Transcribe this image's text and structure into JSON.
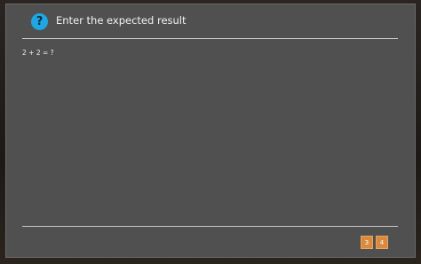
{
  "dialog": {
    "icon": "help-circle-icon",
    "icon_glyph": "?",
    "title": "Enter the expected result",
    "question": "2 + 2 = ?",
    "answers": [
      "3",
      "4"
    ],
    "colors": {
      "panel": "#505050",
      "icon": "#1ea7e3",
      "answer_button": "#d98a3c"
    }
  }
}
